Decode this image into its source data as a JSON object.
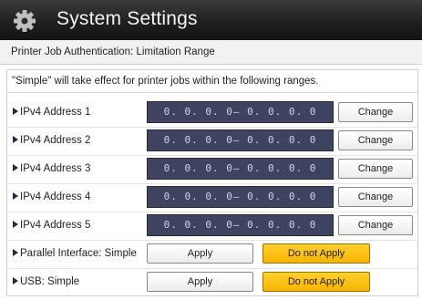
{
  "header": {
    "title": "System Settings",
    "icon": "gear-icon"
  },
  "page_title": "Printer Job Authentication: Limitation Range",
  "info_text": "\"Simple\" will take effect for printer jobs within the following ranges.",
  "ipv4_rows": [
    {
      "label": "IPv4 Address 1",
      "value": "0. 0. 0. 0– 0. 0. 0. 0",
      "button": "Change"
    },
    {
      "label": "IPv4 Address 2",
      "value": "0. 0. 0. 0– 0. 0. 0. 0",
      "button": "Change"
    },
    {
      "label": "IPv4 Address 3",
      "value": "0. 0. 0. 0– 0. 0. 0. 0",
      "button": "Change"
    },
    {
      "label": "IPv4 Address 4",
      "value": "0. 0. 0. 0– 0. 0. 0. 0",
      "button": "Change"
    },
    {
      "label": "IPv4 Address 5",
      "value": "0. 0. 0. 0– 0. 0. 0. 0",
      "button": "Change"
    }
  ],
  "toggle_rows": [
    {
      "label": "Parallel Interface: Simple",
      "apply": "Apply",
      "not_apply": "Do not Apply",
      "selected": "Do not Apply"
    },
    {
      "label": "USB: Simple",
      "apply": "Apply",
      "not_apply": "Do not Apply",
      "selected": "Do not Apply"
    }
  ],
  "colors": {
    "header_bg": "#1f1f1f",
    "address_field_bg": "#3e4460",
    "selected_button": "#f7b400"
  }
}
